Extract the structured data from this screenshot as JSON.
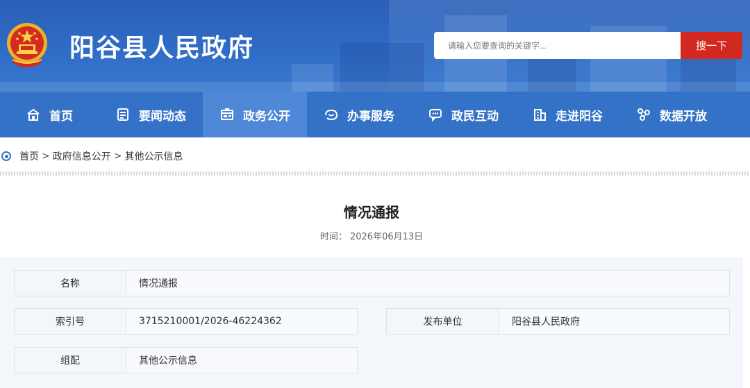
{
  "header": {
    "site_title": "阳谷县人民政府",
    "search_placeholder": "请输入您要查询的关键字...",
    "search_button": "搜一下",
    "brand_color": "#2f6cc6",
    "accent_color": "#d3281f"
  },
  "nav": {
    "items": [
      {
        "label": "首页",
        "icon": "home-icon"
      },
      {
        "label": "要闻动态",
        "icon": "news-icon"
      },
      {
        "label": "政务公开",
        "icon": "open-government-icon",
        "active": true
      },
      {
        "label": "办事服务",
        "icon": "service-icon"
      },
      {
        "label": "政民互动",
        "icon": "chat-icon"
      },
      {
        "label": "走进阳谷",
        "icon": "building-icon"
      },
      {
        "label": "数据开放",
        "icon": "data-icon"
      }
    ]
  },
  "breadcrumb": {
    "items": [
      "首页",
      "政府信息公开",
      "其他公示信息"
    ],
    "separator": ">"
  },
  "article": {
    "title": "情况通报",
    "time_label": "时间：",
    "time_value": "2026年06月13日"
  },
  "info": {
    "name_label": "名称",
    "name_value": "情况通报",
    "index_label": "索引号",
    "index_value": "3715210001/2026-46224362",
    "publisher_label": "发布单位",
    "publisher_value": "阳谷县人民政府",
    "category_label": "组配",
    "category_value": "其他公示信息"
  }
}
